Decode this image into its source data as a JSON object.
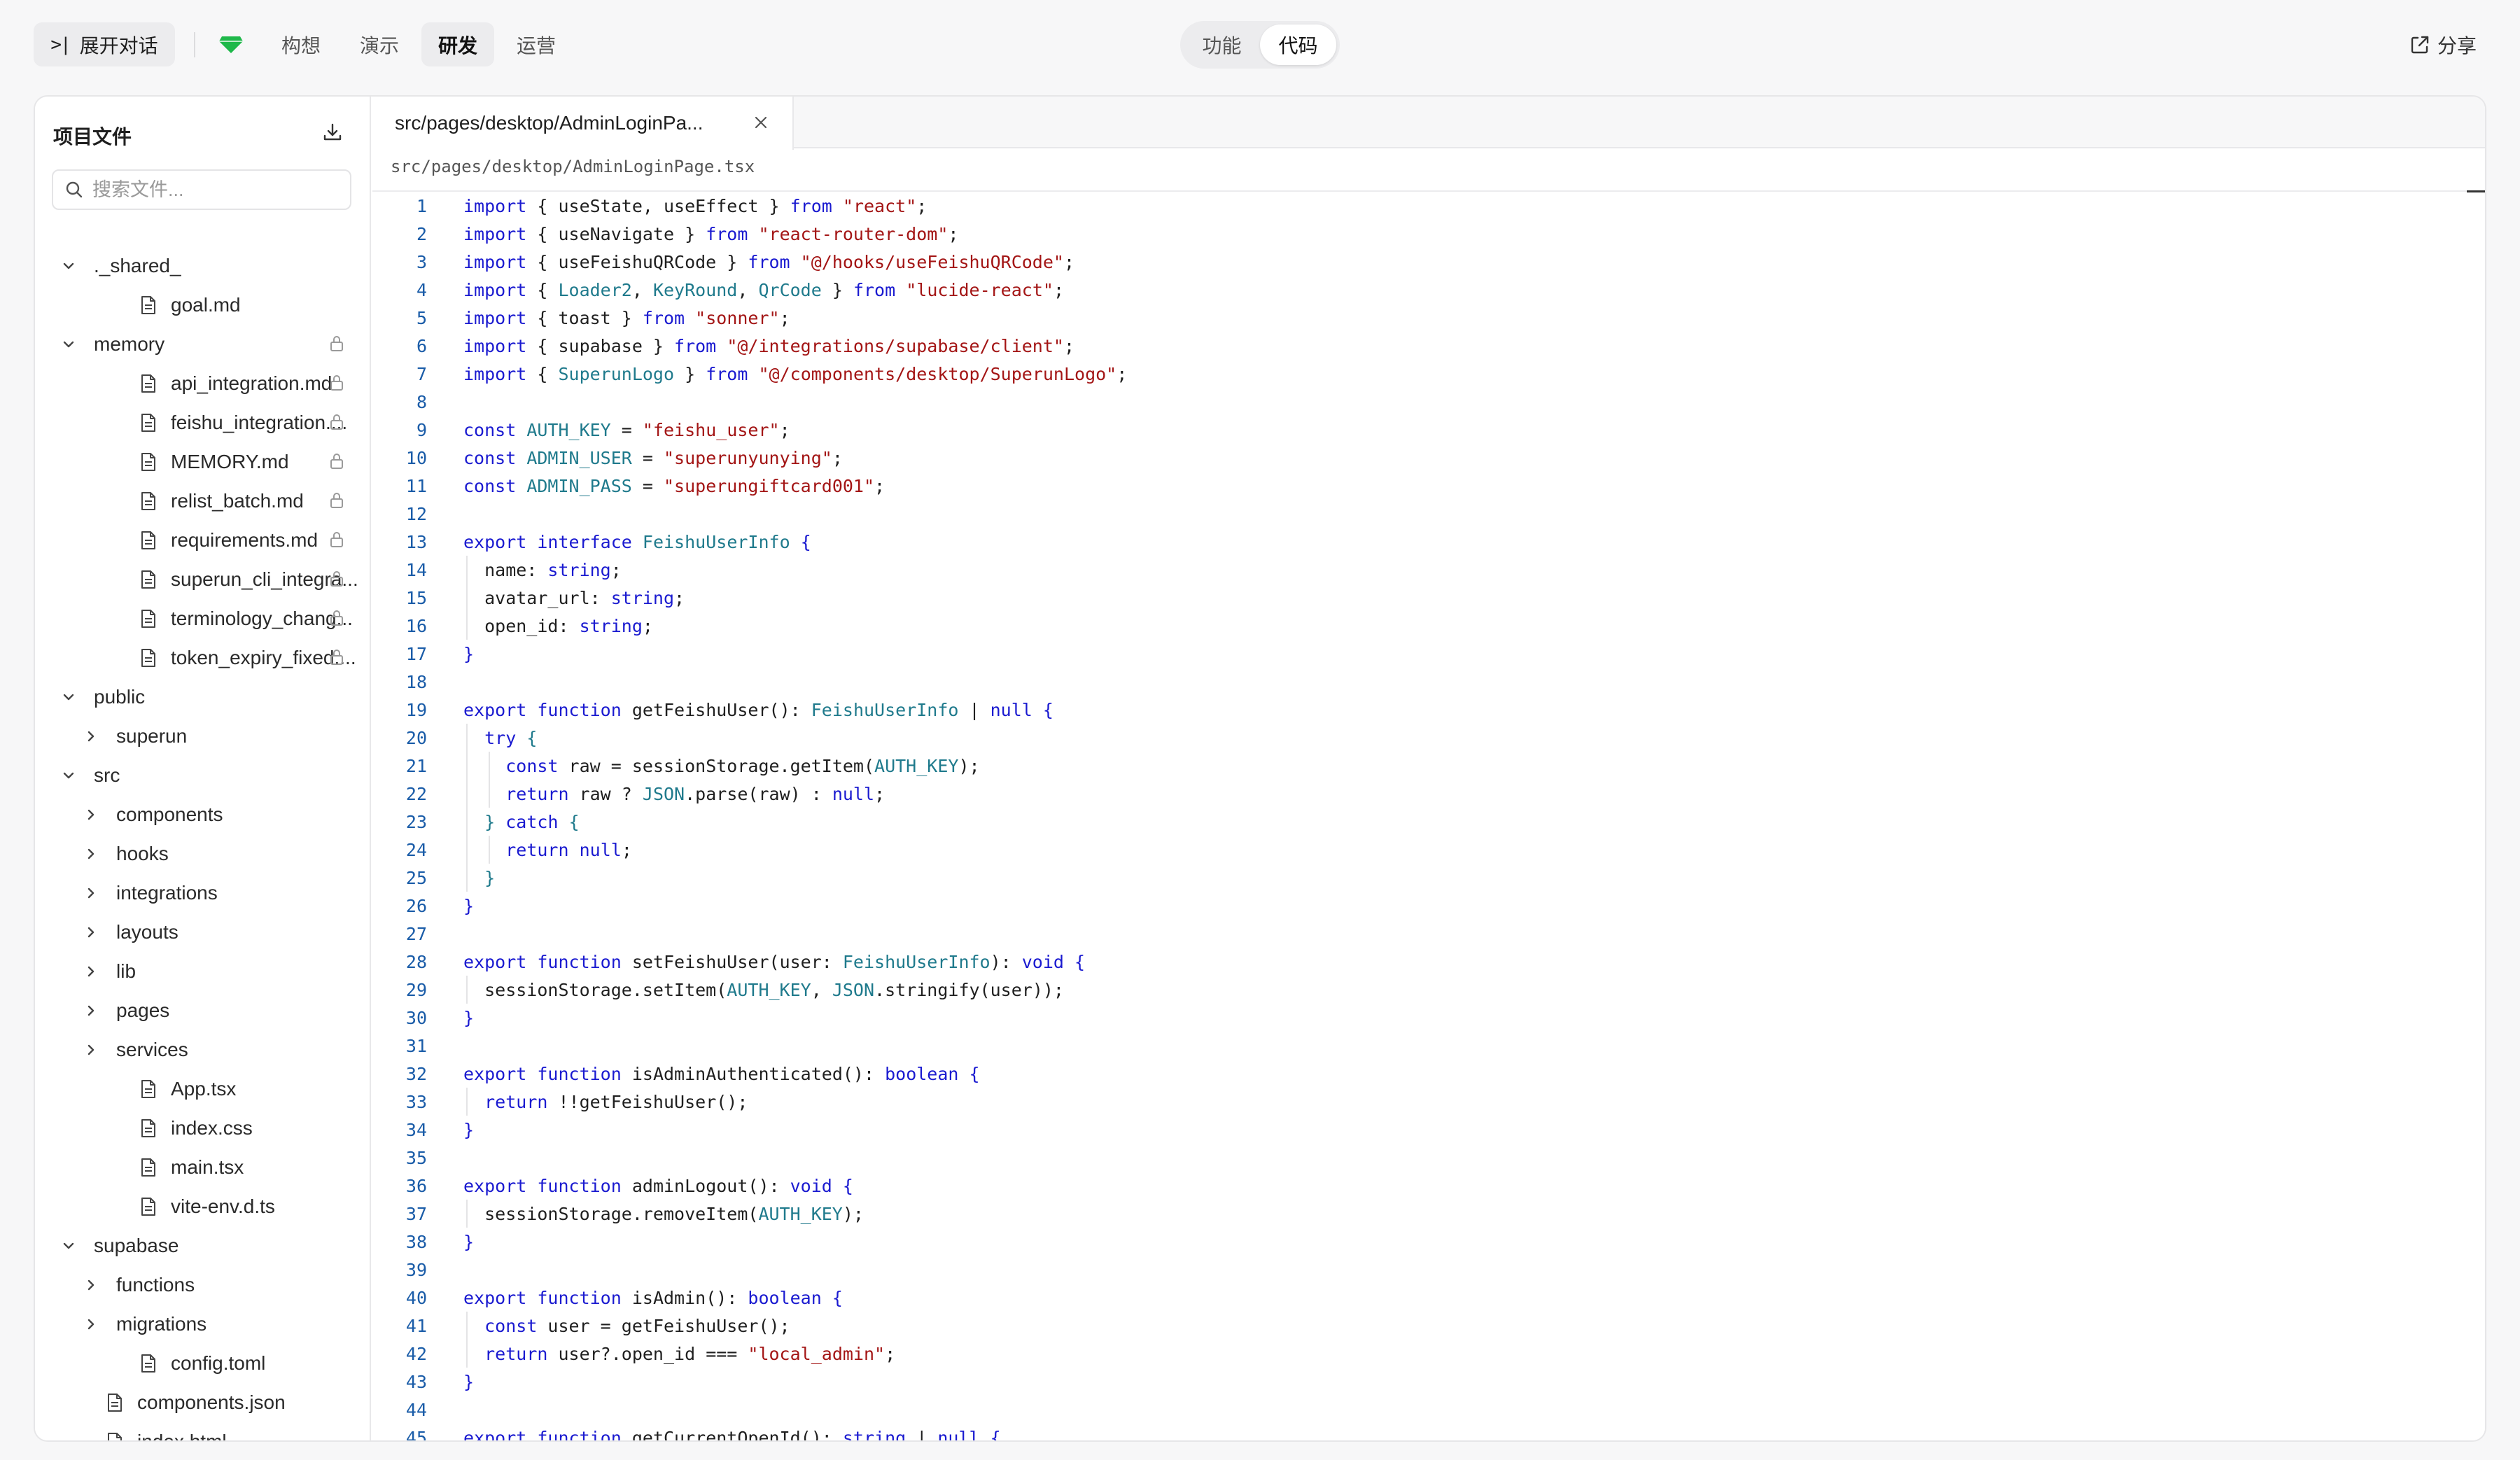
{
  "topbar": {
    "expand_label": "展开对话",
    "expand_icon": ">|",
    "nav_tabs": [
      {
        "label": "构想",
        "active": false
      },
      {
        "label": "演示",
        "active": false
      },
      {
        "label": "研发",
        "active": true
      },
      {
        "label": "运营",
        "active": false
      }
    ],
    "mode_switch": [
      {
        "label": "功能",
        "active": false
      },
      {
        "label": "代码",
        "active": true
      }
    ],
    "share_label": "分享",
    "accent_color": "#1fb84a"
  },
  "sidebar": {
    "title": "项目文件",
    "search_placeholder": "搜索文件...",
    "tree": [
      {
        "name": "._shared_",
        "type": "folder",
        "expanded": true,
        "depth": 0,
        "locked": false
      },
      {
        "name": "goal.md",
        "type": "file",
        "depth": 1,
        "locked": false
      },
      {
        "name": "memory",
        "type": "folder",
        "expanded": true,
        "depth": 0,
        "locked": true
      },
      {
        "name": "api_integration.md",
        "type": "file",
        "depth": 1,
        "locked": true
      },
      {
        "name": "feishu_integration....",
        "type": "file",
        "depth": 1,
        "locked": true
      },
      {
        "name": "MEMORY.md",
        "type": "file",
        "depth": 1,
        "locked": true
      },
      {
        "name": "relist_batch.md",
        "type": "file",
        "depth": 1,
        "locked": true
      },
      {
        "name": "requirements.md",
        "type": "file",
        "depth": 1,
        "locked": true
      },
      {
        "name": "superun_cli_integra...",
        "type": "file",
        "depth": 1,
        "locked": true
      },
      {
        "name": "terminology_chang...",
        "type": "file",
        "depth": 1,
        "locked": true
      },
      {
        "name": "token_expiry_fixed....",
        "type": "file",
        "depth": 1,
        "locked": true
      },
      {
        "name": "public",
        "type": "folder",
        "expanded": true,
        "depth": 0,
        "locked": false
      },
      {
        "name": "superun",
        "type": "folder",
        "expanded": false,
        "depth": 1,
        "locked": false
      },
      {
        "name": "src",
        "type": "folder",
        "expanded": true,
        "depth": 0,
        "locked": false
      },
      {
        "name": "components",
        "type": "folder",
        "expanded": false,
        "depth": 1,
        "locked": false
      },
      {
        "name": "hooks",
        "type": "folder",
        "expanded": false,
        "depth": 1,
        "locked": false
      },
      {
        "name": "integrations",
        "type": "folder",
        "expanded": false,
        "depth": 1,
        "locked": false
      },
      {
        "name": "layouts",
        "type": "folder",
        "expanded": false,
        "depth": 1,
        "locked": false
      },
      {
        "name": "lib",
        "type": "folder",
        "expanded": false,
        "depth": 1,
        "locked": false
      },
      {
        "name": "pages",
        "type": "folder",
        "expanded": false,
        "depth": 1,
        "locked": false
      },
      {
        "name": "services",
        "type": "folder",
        "expanded": false,
        "depth": 1,
        "locked": false
      },
      {
        "name": "App.tsx",
        "type": "file",
        "depth": 1,
        "locked": false
      },
      {
        "name": "index.css",
        "type": "file",
        "depth": 1,
        "locked": false
      },
      {
        "name": "main.tsx",
        "type": "file",
        "depth": 1,
        "locked": false
      },
      {
        "name": "vite-env.d.ts",
        "type": "file",
        "depth": 1,
        "locked": false
      },
      {
        "name": "supabase",
        "type": "folder",
        "expanded": true,
        "depth": 0,
        "locked": false
      },
      {
        "name": "functions",
        "type": "folder",
        "expanded": false,
        "depth": 1,
        "locked": false
      },
      {
        "name": "migrations",
        "type": "folder",
        "expanded": false,
        "depth": 1,
        "locked": false
      },
      {
        "name": "config.toml",
        "type": "file",
        "depth": 1,
        "locked": false
      },
      {
        "name": "components.json",
        "type": "file",
        "depth": 0,
        "locked": false
      },
      {
        "name": "index.html",
        "type": "file",
        "depth": 0,
        "locked": false
      }
    ]
  },
  "editor": {
    "tab_label": "src/pages/desktop/AdminLoginPa...",
    "breadcrumb": "src/pages/desktop/AdminLoginPage.tsx",
    "lines": [
      [
        [
          "k",
          "import"
        ],
        [
          "p",
          " { useState, useEffect } "
        ],
        [
          "k",
          "from"
        ],
        [
          "p",
          " "
        ],
        [
          "s",
          "\"react\""
        ],
        [
          "p",
          ";"
        ]
      ],
      [
        [
          "k",
          "import"
        ],
        [
          "p",
          " { useNavigate } "
        ],
        [
          "k",
          "from"
        ],
        [
          "p",
          " "
        ],
        [
          "s",
          "\"react-router-dom\""
        ],
        [
          "p",
          ";"
        ]
      ],
      [
        [
          "k",
          "import"
        ],
        [
          "p",
          " { useFeishuQRCode } "
        ],
        [
          "k",
          "from"
        ],
        [
          "p",
          " "
        ],
        [
          "s",
          "\"@/hooks/useFeishuQRCode\""
        ],
        [
          "p",
          ";"
        ]
      ],
      [
        [
          "k",
          "import"
        ],
        [
          "p",
          " { "
        ],
        [
          "t",
          "Loader2"
        ],
        [
          "p",
          ", "
        ],
        [
          "t",
          "KeyRound"
        ],
        [
          "p",
          ", "
        ],
        [
          "t",
          "QrCode"
        ],
        [
          "p",
          " } "
        ],
        [
          "k",
          "from"
        ],
        [
          "p",
          " "
        ],
        [
          "s",
          "\"lucide-react\""
        ],
        [
          "p",
          ";"
        ]
      ],
      [
        [
          "k",
          "import"
        ],
        [
          "p",
          " { toast } "
        ],
        [
          "k",
          "from"
        ],
        [
          "p",
          " "
        ],
        [
          "s",
          "\"sonner\""
        ],
        [
          "p",
          ";"
        ]
      ],
      [
        [
          "k",
          "import"
        ],
        [
          "p",
          " { supabase } "
        ],
        [
          "k",
          "from"
        ],
        [
          "p",
          " "
        ],
        [
          "s",
          "\"@/integrations/supabase/client\""
        ],
        [
          "p",
          ";"
        ]
      ],
      [
        [
          "k",
          "import"
        ],
        [
          "p",
          " { "
        ],
        [
          "t",
          "SuperunLogo"
        ],
        [
          "p",
          " } "
        ],
        [
          "k",
          "from"
        ],
        [
          "p",
          " "
        ],
        [
          "s",
          "\"@/components/desktop/SuperunLogo\""
        ],
        [
          "p",
          ";"
        ]
      ],
      [],
      [
        [
          "k",
          "const"
        ],
        [
          "p",
          " "
        ],
        [
          "t",
          "AUTH_KEY"
        ],
        [
          "p",
          " = "
        ],
        [
          "s",
          "\"feishu_user\""
        ],
        [
          "p",
          ";"
        ]
      ],
      [
        [
          "k",
          "const"
        ],
        [
          "p",
          " "
        ],
        [
          "t",
          "ADMIN_USER"
        ],
        [
          "p",
          " = "
        ],
        [
          "s",
          "\"superunyunying\""
        ],
        [
          "p",
          ";"
        ]
      ],
      [
        [
          "k",
          "const"
        ],
        [
          "p",
          " "
        ],
        [
          "t",
          "ADMIN_PASS"
        ],
        [
          "p",
          " = "
        ],
        [
          "s",
          "\"superungiftcard001\""
        ],
        [
          "p",
          ";"
        ]
      ],
      [],
      [
        [
          "k",
          "export"
        ],
        [
          "p",
          " "
        ],
        [
          "k",
          "interface"
        ],
        [
          "p",
          " "
        ],
        [
          "t",
          "FeishuUserInfo"
        ],
        [
          "p",
          " "
        ],
        [
          "k",
          "{"
        ]
      ],
      [
        [
          "p",
          "  name: "
        ],
        [
          "k",
          "string"
        ],
        [
          "p",
          ";"
        ]
      ],
      [
        [
          "p",
          "  avatar_url: "
        ],
        [
          "k",
          "string"
        ],
        [
          "p",
          ";"
        ]
      ],
      [
        [
          "p",
          "  open_id: "
        ],
        [
          "k",
          "string"
        ],
        [
          "p",
          ";"
        ]
      ],
      [
        [
          "k",
          "}"
        ]
      ],
      [],
      [
        [
          "k",
          "export"
        ],
        [
          "p",
          " "
        ],
        [
          "k",
          "function"
        ],
        [
          "p",
          " getFeishuUser(): "
        ],
        [
          "t",
          "FeishuUserInfo"
        ],
        [
          "p",
          " | "
        ],
        [
          "k",
          "null"
        ],
        [
          "p",
          " "
        ],
        [
          "k",
          "{"
        ]
      ],
      [
        [
          "p",
          "  "
        ],
        [
          "k",
          "try"
        ],
        [
          "p",
          " "
        ],
        [
          "t",
          "{"
        ]
      ],
      [
        [
          "p",
          "    "
        ],
        [
          "k",
          "const"
        ],
        [
          "p",
          " raw = sessionStorage.getItem("
        ],
        [
          "t",
          "AUTH_KEY"
        ],
        [
          "p",
          ");"
        ]
      ],
      [
        [
          "p",
          "    "
        ],
        [
          "k",
          "return"
        ],
        [
          "p",
          " raw ? "
        ],
        [
          "t",
          "JSON"
        ],
        [
          "p",
          ".parse(raw) : "
        ],
        [
          "k",
          "null"
        ],
        [
          "p",
          ";"
        ]
      ],
      [
        [
          "p",
          "  "
        ],
        [
          "t",
          "}"
        ],
        [
          "p",
          " "
        ],
        [
          "k",
          "catch"
        ],
        [
          "p",
          " "
        ],
        [
          "t",
          "{"
        ]
      ],
      [
        [
          "p",
          "    "
        ],
        [
          "k",
          "return"
        ],
        [
          "p",
          " "
        ],
        [
          "k",
          "null"
        ],
        [
          "p",
          ";"
        ]
      ],
      [
        [
          "p",
          "  "
        ],
        [
          "t",
          "}"
        ]
      ],
      [
        [
          "k",
          "}"
        ]
      ],
      [],
      [
        [
          "k",
          "export"
        ],
        [
          "p",
          " "
        ],
        [
          "k",
          "function"
        ],
        [
          "p",
          " setFeishuUser(user: "
        ],
        [
          "t",
          "FeishuUserInfo"
        ],
        [
          "p",
          "): "
        ],
        [
          "k",
          "void"
        ],
        [
          "p",
          " "
        ],
        [
          "k",
          "{"
        ]
      ],
      [
        [
          "p",
          "  sessionStorage.setItem("
        ],
        [
          "t",
          "AUTH_KEY"
        ],
        [
          "p",
          ", "
        ],
        [
          "t",
          "JSON"
        ],
        [
          "p",
          ".stringify(user));"
        ]
      ],
      [
        [
          "k",
          "}"
        ]
      ],
      [],
      [
        [
          "k",
          "export"
        ],
        [
          "p",
          " "
        ],
        [
          "k",
          "function"
        ],
        [
          "p",
          " isAdminAuthenticated(): "
        ],
        [
          "k",
          "boolean"
        ],
        [
          "p",
          " "
        ],
        [
          "k",
          "{"
        ]
      ],
      [
        [
          "p",
          "  "
        ],
        [
          "k",
          "return"
        ],
        [
          "p",
          " !!getFeishuUser();"
        ]
      ],
      [
        [
          "k",
          "}"
        ]
      ],
      [],
      [
        [
          "k",
          "export"
        ],
        [
          "p",
          " "
        ],
        [
          "k",
          "function"
        ],
        [
          "p",
          " adminLogout(): "
        ],
        [
          "k",
          "void"
        ],
        [
          "p",
          " "
        ],
        [
          "k",
          "{"
        ]
      ],
      [
        [
          "p",
          "  sessionStorage.removeItem("
        ],
        [
          "t",
          "AUTH_KEY"
        ],
        [
          "p",
          ");"
        ]
      ],
      [
        [
          "k",
          "}"
        ]
      ],
      [],
      [
        [
          "k",
          "export"
        ],
        [
          "p",
          " "
        ],
        [
          "k",
          "function"
        ],
        [
          "p",
          " isAdmin(): "
        ],
        [
          "k",
          "boolean"
        ],
        [
          "p",
          " "
        ],
        [
          "k",
          "{"
        ]
      ],
      [
        [
          "p",
          "  "
        ],
        [
          "k",
          "const"
        ],
        [
          "p",
          " user = getFeishuUser();"
        ]
      ],
      [
        [
          "p",
          "  "
        ],
        [
          "k",
          "return"
        ],
        [
          "p",
          " user?.open_id === "
        ],
        [
          "s",
          "\"local_admin\""
        ],
        [
          "p",
          ";"
        ]
      ],
      [
        [
          "k",
          "}"
        ]
      ],
      [],
      [
        [
          "k",
          "export"
        ],
        [
          "p",
          " "
        ],
        [
          "k",
          "function"
        ],
        [
          "p",
          " getCurrentOpenId(): "
        ],
        [
          "k",
          "string"
        ],
        [
          "p",
          " | "
        ],
        [
          "k",
          "null"
        ],
        [
          "p",
          " "
        ],
        [
          "k",
          "{"
        ]
      ]
    ],
    "indent_guides": [
      14,
      15,
      16,
      20,
      21,
      22,
      23,
      24,
      25,
      29,
      33,
      37,
      41,
      42
    ]
  }
}
